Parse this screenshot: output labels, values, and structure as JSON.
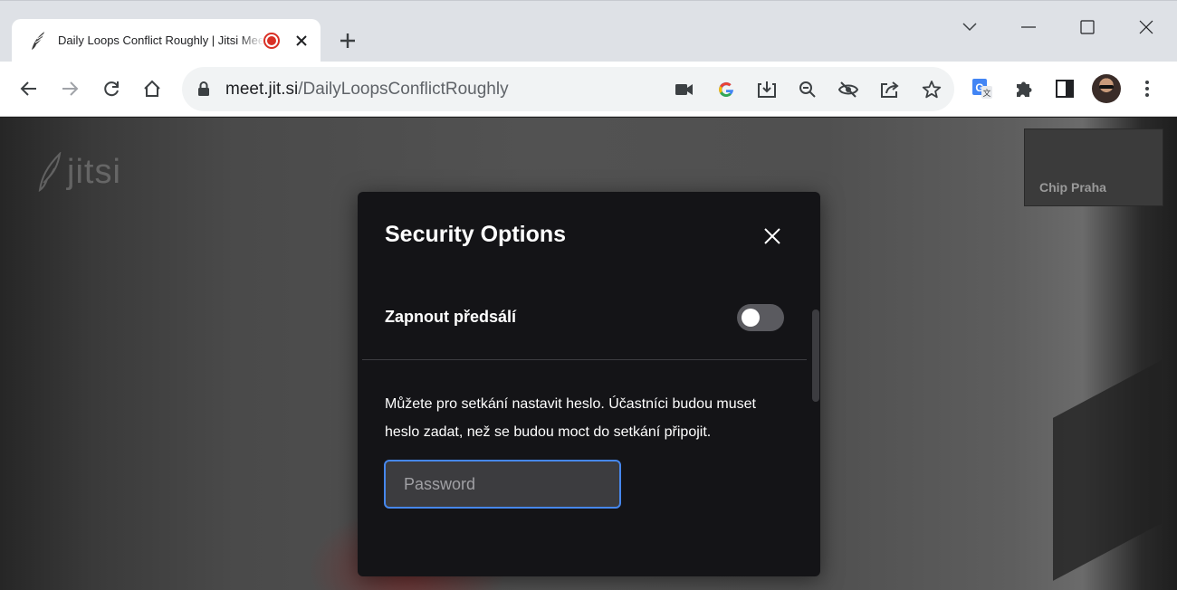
{
  "browser": {
    "tab": {
      "title": "Daily Loops Conflict Roughly | Jitsi Meet",
      "favicon": "jitsi-favicon-icon",
      "recording": true
    },
    "new_tab_label": "+",
    "url_host": "meet.jit.si",
    "url_path": "/DailyLoopsConflictRoughly",
    "omnibox_icons": [
      "camera-icon",
      "google-icon",
      "install-icon",
      "zoom-out-icon",
      "hide-icon",
      "share-icon",
      "star-icon"
    ],
    "extension_icons": [
      "translate-icon",
      "puzzle-icon",
      "side-panel-icon",
      "avatar",
      "kebab-menu-icon"
    ],
    "accent_color": "#1a73e8"
  },
  "meeting": {
    "logo_text": "jitsi",
    "participant_name": "Chip Praha"
  },
  "dialog": {
    "title": "Security Options",
    "lobby_label": "Zapnout předsálí",
    "lobby_enabled": false,
    "description": "Můžete pro setkání nastavit heslo. Účastníci budou muset heslo zadat, než se budou moct do setkání připojit.",
    "password_placeholder": "Password",
    "password_value": ""
  }
}
